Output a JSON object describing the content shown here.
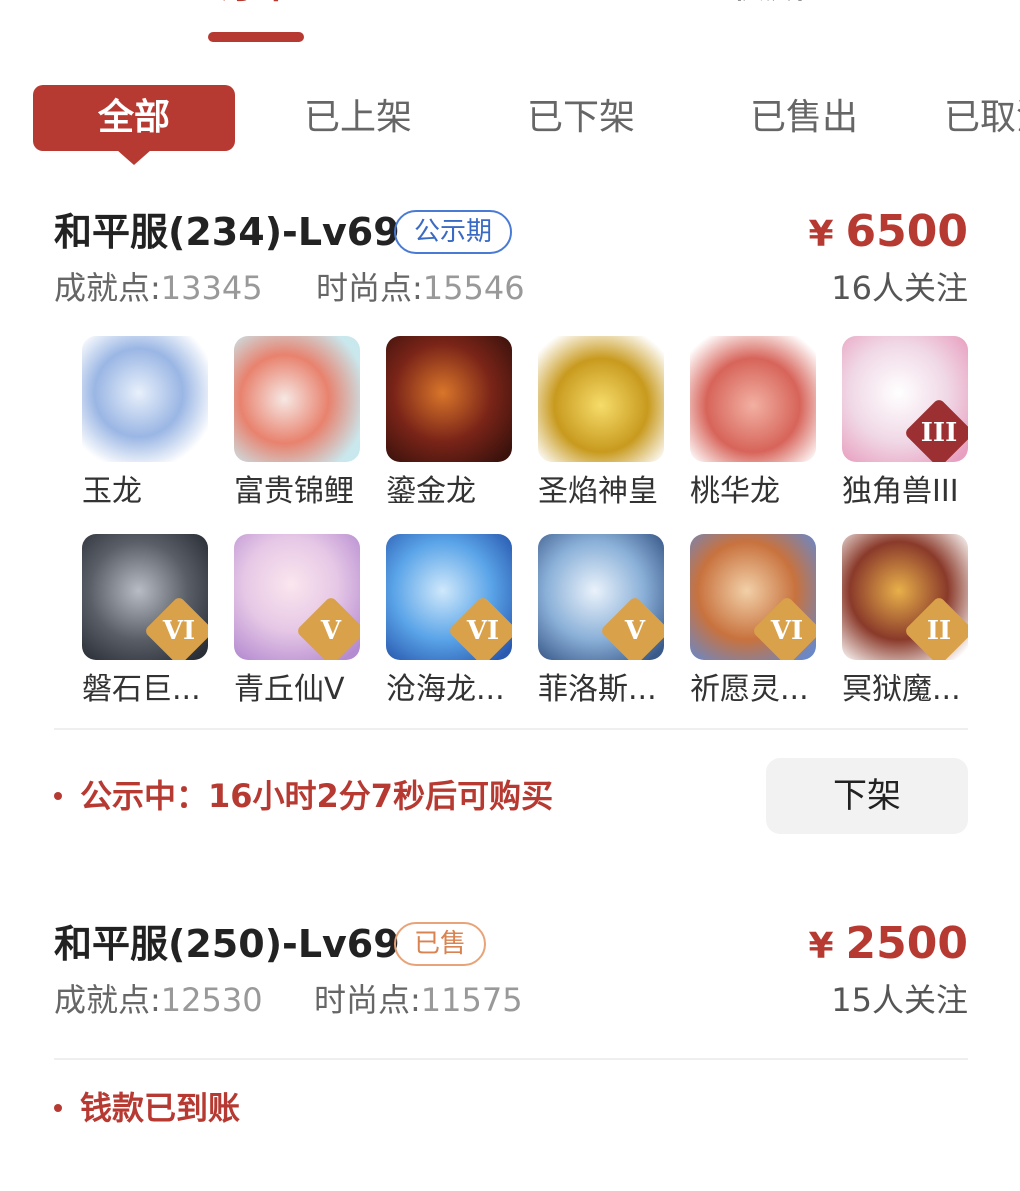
{
  "top_tabs": [
    "订单",
    "收藏"
  ],
  "filter_tabs": [
    {
      "label": "全部",
      "active": true
    },
    {
      "label": "已上架",
      "active": false
    },
    {
      "label": "已下架",
      "active": false
    },
    {
      "label": "已售出",
      "active": false
    },
    {
      "label": "已取消",
      "active": false
    }
  ],
  "listings": [
    {
      "server_title": "和平服(234)-Lv69",
      "badge": "公示期",
      "price_symbol": "¥",
      "price": "6500",
      "achievement_label": "成就点:",
      "achievement_value": "13345",
      "fashion_label": "时尚点:",
      "fashion_value": "15546",
      "followers": "16人关注",
      "pets": [
        {
          "name": "玉龙",
          "tier": "",
          "color": "#7b9fd6"
        },
        {
          "name": "富贵锦鲤",
          "tier": "",
          "color": "#e8826e"
        },
        {
          "name": "鎏金龙",
          "tier": "",
          "color": "#7a2418"
        },
        {
          "name": "圣焰神皇",
          "tier": "",
          "color": "#d8b234"
        },
        {
          "name": "桃华龙",
          "tier": "",
          "color": "#e07a6a"
        },
        {
          "name": "独角兽III",
          "tier": "III",
          "color": "#f0d8e6"
        },
        {
          "name": "磐石巨...",
          "tier": "VI",
          "color": "#5a5e66"
        },
        {
          "name": "青丘仙V",
          "tier": "V",
          "color": "#e6c8e6"
        },
        {
          "name": "沧海龙...",
          "tier": "VI",
          "color": "#5aa4e8"
        },
        {
          "name": "菲洛斯...",
          "tier": "V",
          "color": "#8ab0d8"
        },
        {
          "name": "祈愿灵...",
          "tier": "VI",
          "color": "#c8723e"
        },
        {
          "name": "冥狱魔...",
          "tier": "II",
          "color": "#8a3a2a"
        }
      ],
      "status": "公示中：16小时2分7秒后可购买",
      "action": "下架"
    },
    {
      "server_title": "和平服(250)-Lv69",
      "badge": "已售",
      "price_symbol": "¥",
      "price": "2500",
      "achievement_label": "成就点:",
      "achievement_value": "12530",
      "fashion_label": "时尚点:",
      "fashion_value": "11575",
      "followers": "15人关注",
      "status": "钱款已到账"
    }
  ],
  "colors": {
    "accent": "#b73a32",
    "public_badge": "#4a7bd4",
    "sold_badge": "#e8a378"
  }
}
